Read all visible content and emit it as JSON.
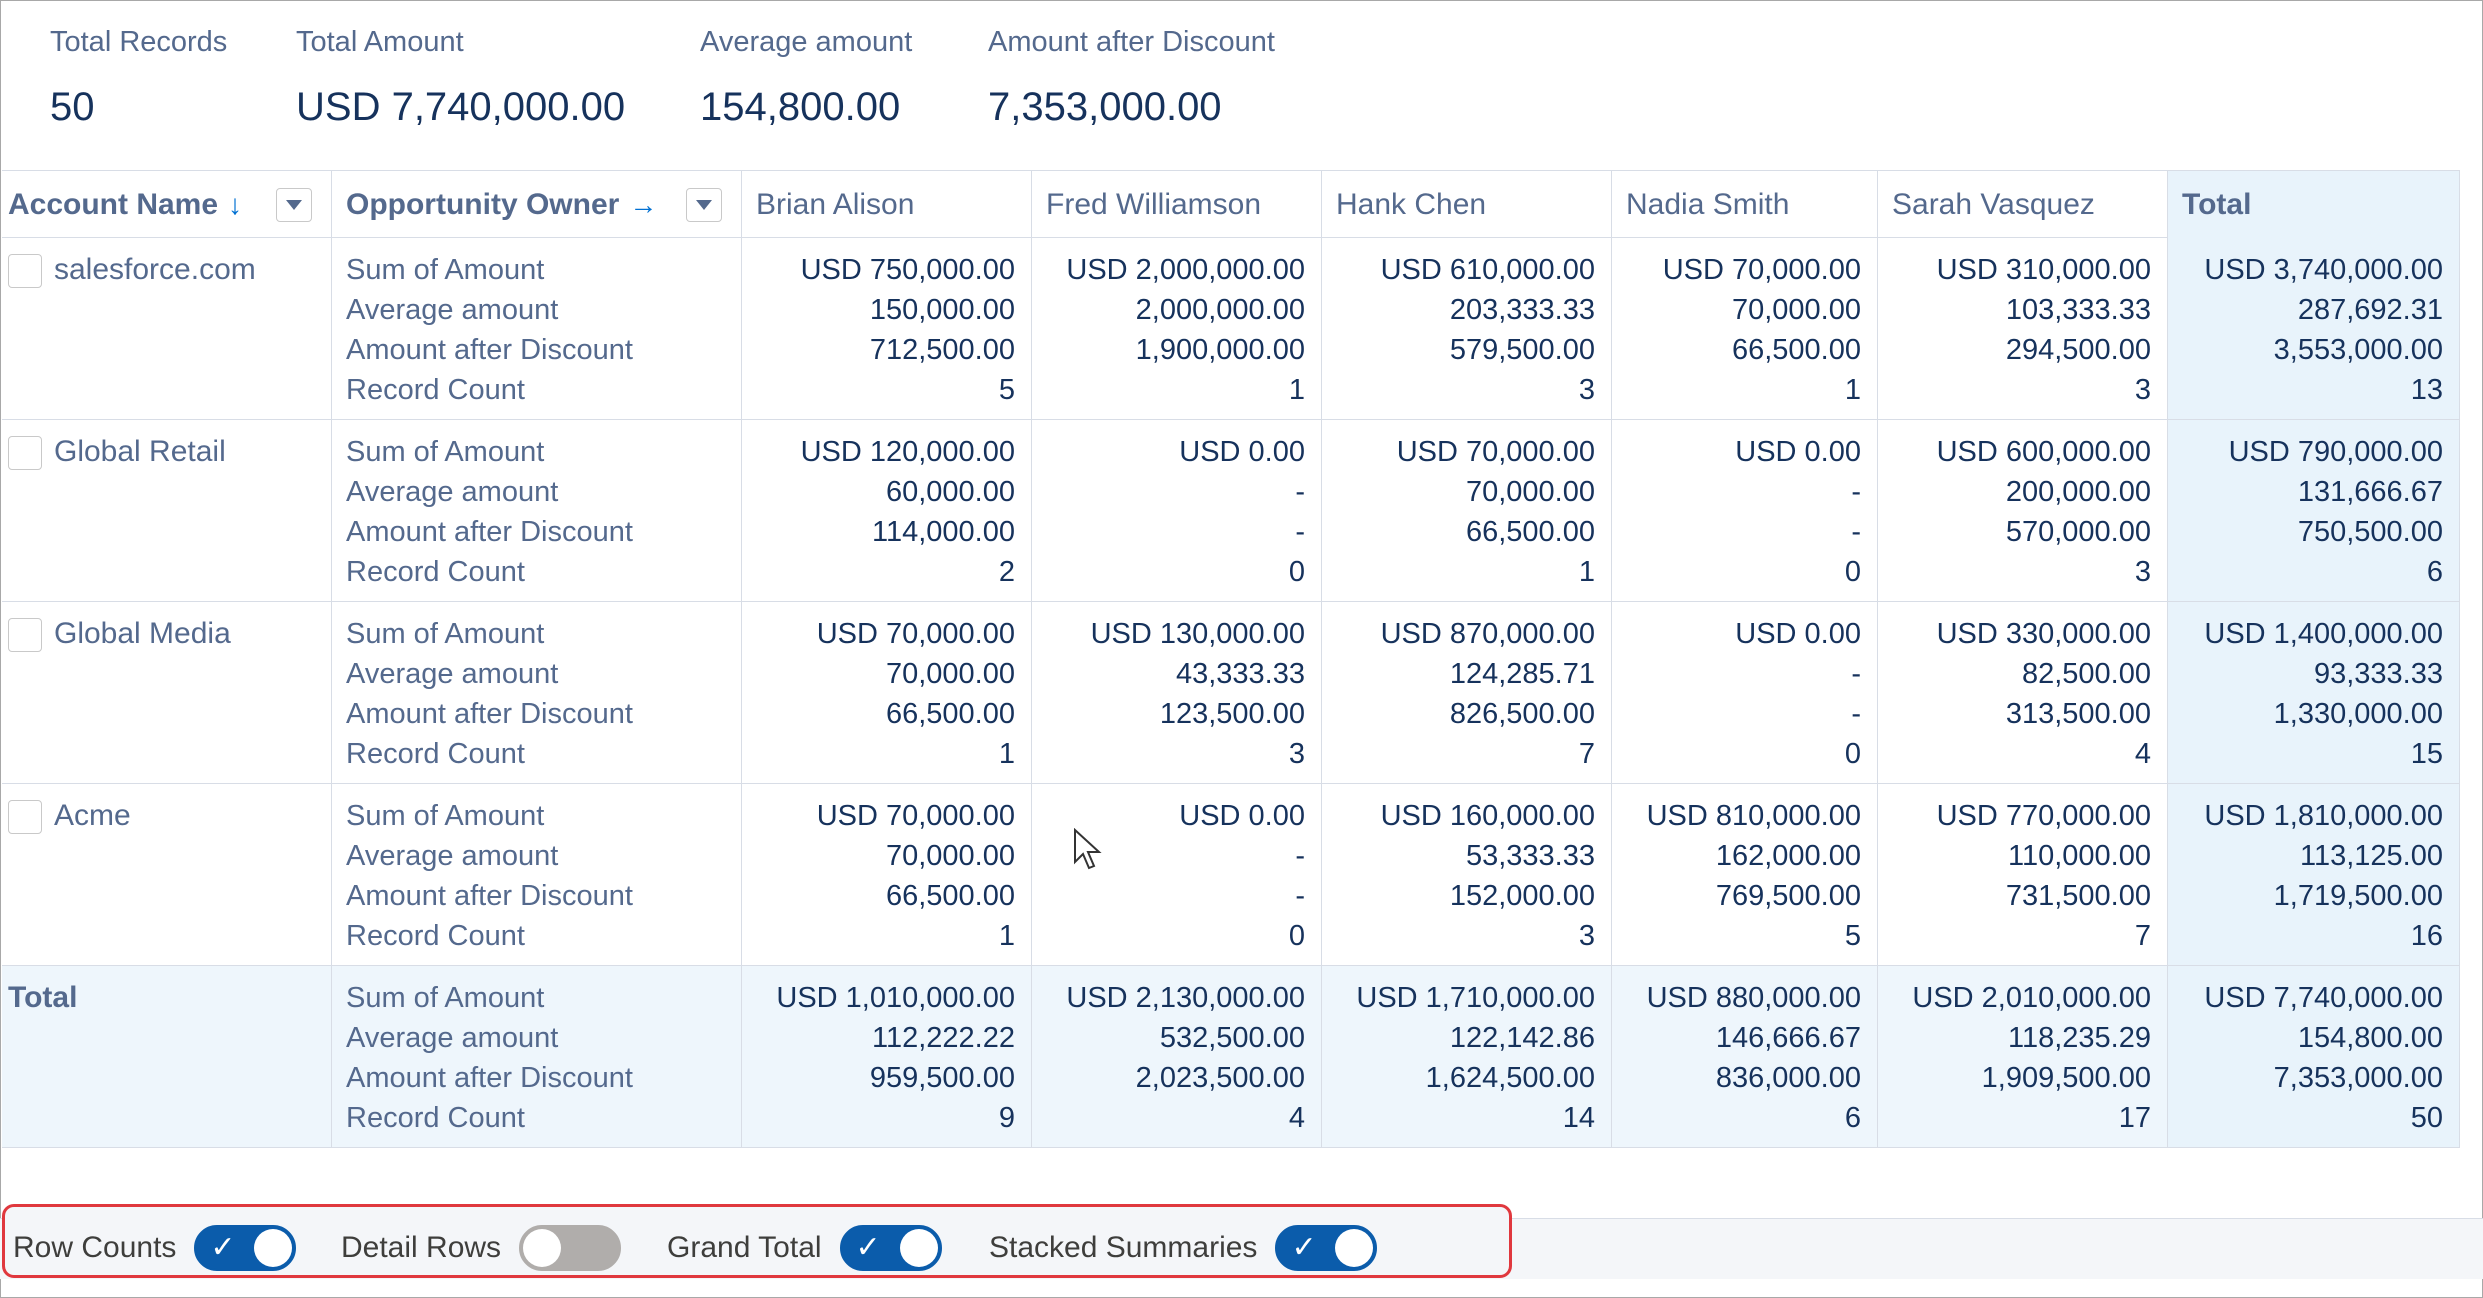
{
  "summary": [
    {
      "label": "Total Records",
      "value": "50"
    },
    {
      "label": "Total Amount",
      "value": "USD 7,740,000.00"
    },
    {
      "label": "Average amount",
      "value": "154,800.00"
    },
    {
      "label": "Amount after Discount",
      "value": "7,353,000.00"
    }
  ],
  "columns": {
    "account": "Account Name",
    "owner": "Opportunity Owner",
    "owners": [
      "Brian Alison",
      "Fred Williamson",
      "Hank Chen",
      "Nadia Smith",
      "Sarah Vasquez"
    ],
    "total": "Total"
  },
  "measures": [
    "Sum of Amount",
    "Average amount",
    "Amount after Discount",
    "Record Count"
  ],
  "rows": [
    {
      "account": "salesforce.com",
      "cells": [
        [
          "USD 750,000.00",
          "150,000.00",
          "712,500.00",
          "5"
        ],
        [
          "USD 2,000,000.00",
          "2,000,000.00",
          "1,900,000.00",
          "1"
        ],
        [
          "USD 610,000.00",
          "203,333.33",
          "579,500.00",
          "3"
        ],
        [
          "USD 70,000.00",
          "70,000.00",
          "66,500.00",
          "1"
        ],
        [
          "USD 310,000.00",
          "103,333.33",
          "294,500.00",
          "3"
        ],
        [
          "USD 3,740,000.00",
          "287,692.31",
          "3,553,000.00",
          "13"
        ]
      ]
    },
    {
      "account": "Global Retail",
      "cells": [
        [
          "USD 120,000.00",
          "60,000.00",
          "114,000.00",
          "2"
        ],
        [
          "USD 0.00",
          "-",
          "-",
          "0"
        ],
        [
          "USD 70,000.00",
          "70,000.00",
          "66,500.00",
          "1"
        ],
        [
          "USD 0.00",
          "-",
          "-",
          "0"
        ],
        [
          "USD 600,000.00",
          "200,000.00",
          "570,000.00",
          "3"
        ],
        [
          "USD 790,000.00",
          "131,666.67",
          "750,500.00",
          "6"
        ]
      ]
    },
    {
      "account": "Global Media",
      "cells": [
        [
          "USD 70,000.00",
          "70,000.00",
          "66,500.00",
          "1"
        ],
        [
          "USD 130,000.00",
          "43,333.33",
          "123,500.00",
          "3"
        ],
        [
          "USD 870,000.00",
          "124,285.71",
          "826,500.00",
          "7"
        ],
        [
          "USD 0.00",
          "-",
          "-",
          "0"
        ],
        [
          "USD 330,000.00",
          "82,500.00",
          "313,500.00",
          "4"
        ],
        [
          "USD 1,400,000.00",
          "93,333.33",
          "1,330,000.00",
          "15"
        ]
      ]
    },
    {
      "account": "Acme",
      "cells": [
        [
          "USD 70,000.00",
          "70,000.00",
          "66,500.00",
          "1"
        ],
        [
          "USD 0.00",
          "-",
          "-",
          "0"
        ],
        [
          "USD 160,000.00",
          "53,333.33",
          "152,000.00",
          "3"
        ],
        [
          "USD 810,000.00",
          "162,000.00",
          "769,500.00",
          "5"
        ],
        [
          "USD 770,000.00",
          "110,000.00",
          "731,500.00",
          "7"
        ],
        [
          "USD 1,810,000.00",
          "113,125.00",
          "1,719,500.00",
          "16"
        ]
      ]
    }
  ],
  "total_row": {
    "label": "Total",
    "cells": [
      [
        "USD 1,010,000.00",
        "112,222.22",
        "959,500.00",
        "9"
      ],
      [
        "USD 2,130,000.00",
        "532,500.00",
        "2,023,500.00",
        "4"
      ],
      [
        "USD 1,710,000.00",
        "122,142.86",
        "1,624,500.00",
        "14"
      ],
      [
        "USD 880,000.00",
        "146,666.67",
        "836,000.00",
        "6"
      ],
      [
        "USD 2,010,000.00",
        "118,235.29",
        "1,909,500.00",
        "17"
      ],
      [
        "USD 7,740,000.00",
        "154,800.00",
        "7,353,000.00",
        "50"
      ]
    ]
  },
  "toggles": [
    {
      "label": "Row Counts",
      "on": true
    },
    {
      "label": "Detail Rows",
      "on": false
    },
    {
      "label": "Grand Total",
      "on": true
    },
    {
      "label": "Stacked Summaries",
      "on": true
    }
  ],
  "colors": {
    "accent": "#0b5cab",
    "highlight_border": "#e0383e",
    "total_bg": "#e8f3fb"
  }
}
